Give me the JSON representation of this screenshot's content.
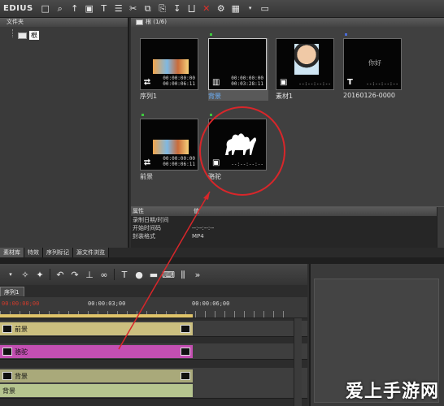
{
  "app": {
    "name": "EDIUS"
  },
  "folder_panel": {
    "title": "文件夹",
    "root_label": "根"
  },
  "bin": {
    "title": "根 (1/6)",
    "clips": [
      {
        "label": "序列1",
        "tc_in": "00:00:00:00",
        "tc_out": "00:00:06:11",
        "type_icon": "sequence-icon"
      },
      {
        "label": "背景",
        "tc_in": "00:00:00:00",
        "tc_out": "00:03:28:11",
        "type_icon": "color-bar-icon",
        "selected": true
      },
      {
        "label": "素材1",
        "tc_in": "--:--:--:--",
        "type_icon": "camera-icon"
      },
      {
        "label": "20160126-0000",
        "text": "你好",
        "tc_in": "--:--:--:--",
        "type_icon": "title-icon"
      },
      {
        "label": "前景",
        "tc_in": "00:00:00:00",
        "tc_out": "00:00:06:11",
        "type_icon": "sequence-icon"
      },
      {
        "label": "骆驼",
        "tc_in": "--:--:--:--",
        "type_icon": "camera-icon"
      }
    ]
  },
  "properties": {
    "col_property": "属性",
    "col_value": "值",
    "rows": [
      {
        "name": "录制日期/时间",
        "value": ""
      },
      {
        "name": "开始时间码",
        "value": "--:--:--:--"
      },
      {
        "name": "封装格式",
        "value": "MP4"
      }
    ]
  },
  "tabs": [
    "素材库",
    "特效",
    "序列标记",
    "源文件浏览"
  ],
  "timeline": {
    "sequence_tab": "序列1",
    "ruler": [
      "00:00:00;00",
      "00:00:03;00",
      "00:00:06;00"
    ],
    "tracks": [
      {
        "clip": "前景",
        "color": "#cbbf7f"
      },
      {
        "clip": "骆驼",
        "color": "#c44fb2"
      },
      {
        "clip": "背景",
        "color": "#a9a97a"
      },
      {
        "clip": "背景",
        "color": "#b6c58f"
      }
    ]
  },
  "watermark": "爱上手游网"
}
